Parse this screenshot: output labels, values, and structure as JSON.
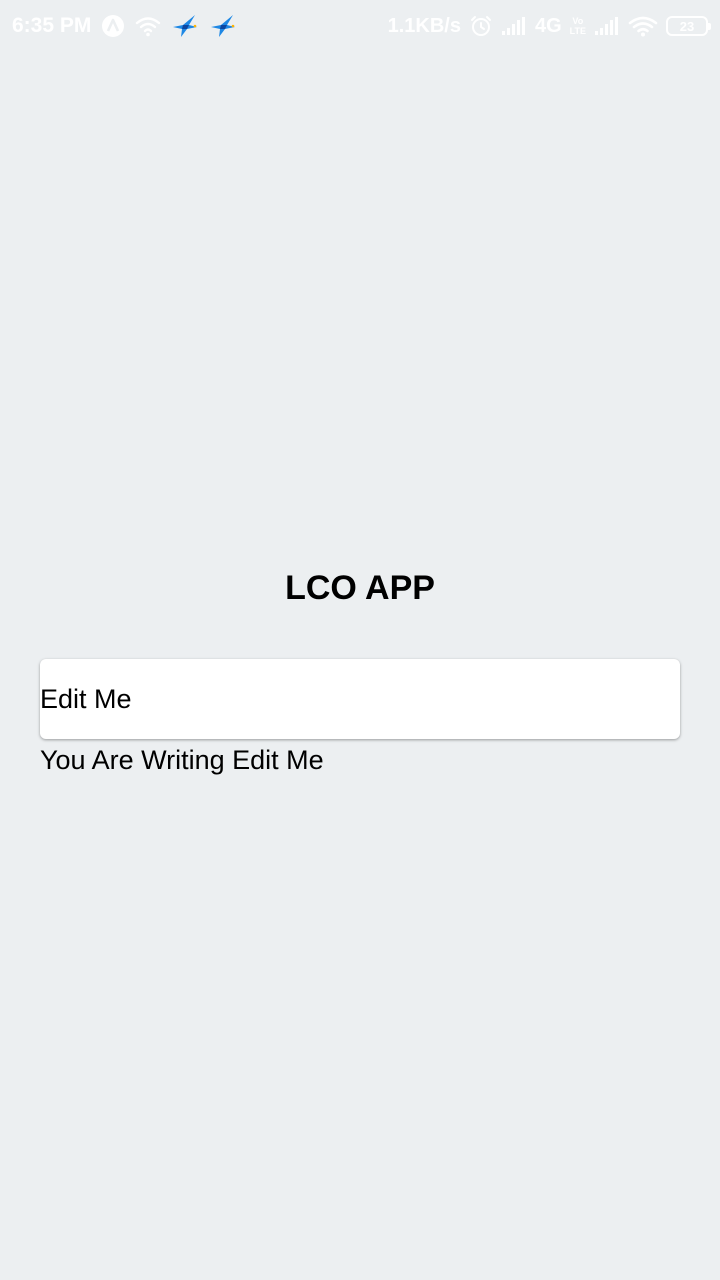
{
  "status_bar": {
    "time": "6:35 PM",
    "speed": "1.1KB/s",
    "network_type": "4G",
    "volte_top": "Vo",
    "volte_bottom": "LTE",
    "battery_level": "23",
    "icons": [
      "app-a-icon",
      "wifi-icon",
      "bird-icon",
      "bird-icon",
      "alarm-icon",
      "signal-icon",
      "signal-icon",
      "wifi-icon",
      "battery-icon"
    ]
  },
  "main": {
    "title": "LCO APP",
    "input_value": "Edit Me",
    "echo_text": "You Are Writing Edit Me"
  },
  "colors": {
    "background": "#ECEFF1",
    "input_background": "#FFFFFF",
    "text": "#000000",
    "status_bar_text": "#FFFFFF",
    "bird_blue": "#1E88E5"
  }
}
